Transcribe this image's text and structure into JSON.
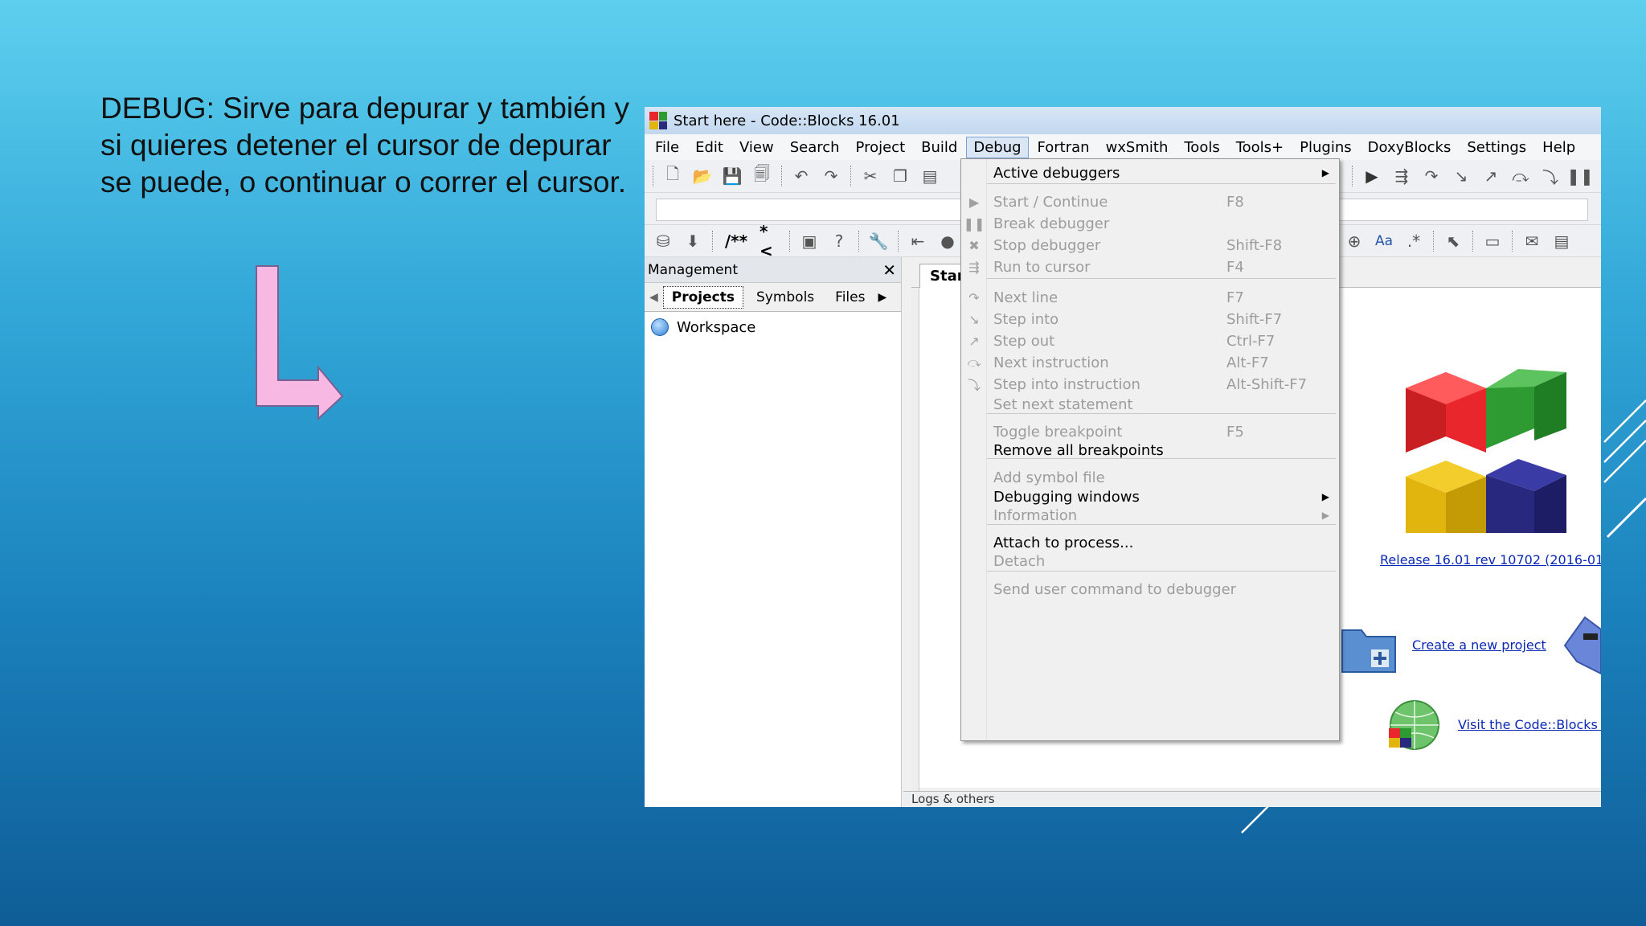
{
  "slide": {
    "text": "DEBUG: Sirve para depurar y también y si quieres detener el cursor de depurar se puede, o continuar o correr el cursor."
  },
  "window": {
    "title": "Start here - Code::Blocks 16.01",
    "menu": [
      "File",
      "Edit",
      "View",
      "Search",
      "Project",
      "Build",
      "Debug",
      "Fortran",
      "wxSmith",
      "Tools",
      "Tools+",
      "Plugins",
      "DoxyBlocks",
      "Settings",
      "Help"
    ],
    "active_menu": "Debug"
  },
  "toolbar3": {
    "doc_comment": "/**",
    "inline_comment": "*<",
    "font_label": "Aa"
  },
  "management": {
    "title": "Management",
    "tabs": [
      "Projects",
      "Symbols",
      "Files"
    ],
    "tree_root": "Workspace"
  },
  "editor": {
    "tab": "Start",
    "logs_label": "Logs & others"
  },
  "start_page": {
    "release": "Release 16.01 rev 10702 (2016-01-",
    "create_link": "Create a new project",
    "visit_link": "Visit the Code::Blocks f"
  },
  "debug_menu": {
    "items": [
      {
        "label": "Active debuggers",
        "shortcut": "",
        "enabled": true,
        "submenu": true,
        "icon": ""
      },
      {
        "label": "Start / Continue",
        "shortcut": "F8",
        "enabled": false,
        "submenu": false,
        "icon": "play-icon"
      },
      {
        "label": "Break debugger",
        "shortcut": "",
        "enabled": false,
        "submenu": false,
        "icon": "pause-icon"
      },
      {
        "label": "Stop debugger",
        "shortcut": "Shift-F8",
        "enabled": false,
        "submenu": false,
        "icon": "stop-icon"
      },
      {
        "label": "Run to cursor",
        "shortcut": "F4",
        "enabled": false,
        "submenu": false,
        "icon": "run-to-cursor-icon"
      },
      {
        "label": "Next line",
        "shortcut": "F7",
        "enabled": false,
        "submenu": false,
        "icon": "next-line-icon"
      },
      {
        "label": "Step into",
        "shortcut": "Shift-F7",
        "enabled": false,
        "submenu": false,
        "icon": "step-into-icon"
      },
      {
        "label": "Step out",
        "shortcut": "Ctrl-F7",
        "enabled": false,
        "submenu": false,
        "icon": "step-out-icon"
      },
      {
        "label": "Next instruction",
        "shortcut": "Alt-F7",
        "enabled": false,
        "submenu": false,
        "icon": "next-instruction-icon"
      },
      {
        "label": "Step into instruction",
        "shortcut": "Alt-Shift-F7",
        "enabled": false,
        "submenu": false,
        "icon": "step-into-instruction-icon"
      },
      {
        "label": "Set next statement",
        "shortcut": "",
        "enabled": false,
        "submenu": false,
        "icon": ""
      },
      {
        "label": "Toggle breakpoint",
        "shortcut": "F5",
        "enabled": false,
        "submenu": false,
        "icon": ""
      },
      {
        "label": "Remove all breakpoints",
        "shortcut": "",
        "enabled": true,
        "submenu": false,
        "icon": ""
      },
      {
        "label": "Add symbol file",
        "shortcut": "",
        "enabled": false,
        "submenu": false,
        "icon": ""
      },
      {
        "label": "Debugging windows",
        "shortcut": "",
        "enabled": true,
        "submenu": true,
        "icon": ""
      },
      {
        "label": "Information",
        "shortcut": "",
        "enabled": false,
        "submenu": true,
        "icon": ""
      },
      {
        "label": "Attach to process...",
        "shortcut": "",
        "enabled": true,
        "submenu": false,
        "icon": ""
      },
      {
        "label": "Detach",
        "shortcut": "",
        "enabled": false,
        "submenu": false,
        "icon": ""
      },
      {
        "label": "Send user command to debugger",
        "shortcut": "",
        "enabled": false,
        "submenu": false,
        "icon": ""
      }
    ]
  },
  "colors": {
    "logo_red": "#e8262b",
    "logo_green": "#2d9b32",
    "logo_yellow": "#e1b40e",
    "logo_blue": "#28287f",
    "arrow_fill": "#f7b8e4",
    "link": "#0b28b5"
  }
}
